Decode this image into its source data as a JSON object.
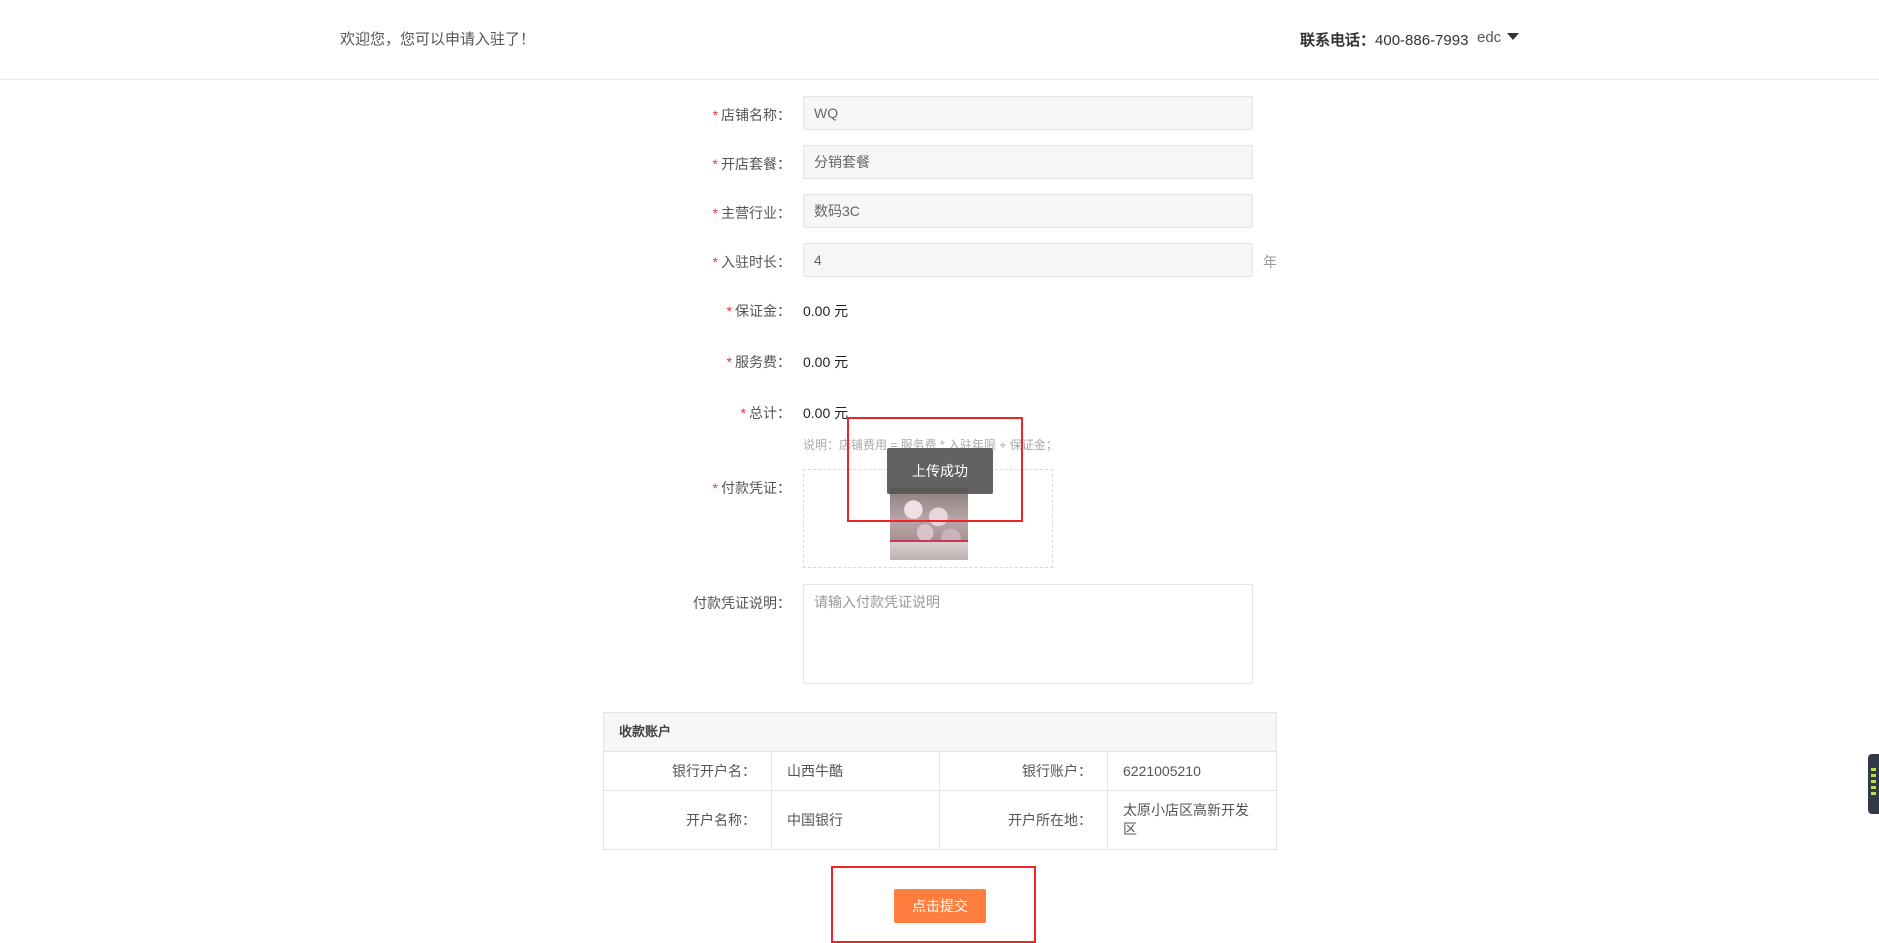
{
  "header": {
    "welcome_text": "欢迎您，您可以申请入驻了！",
    "contact_label": "联系电话：",
    "contact_phone": "400-886-7993",
    "username": "edc"
  },
  "form": {
    "shop_name": {
      "label": "店铺名称：",
      "value": "WQ"
    },
    "package": {
      "label": "开店套餐：",
      "value": "分销套餐"
    },
    "industry": {
      "label": "主营行业：",
      "value": "数码3C"
    },
    "duration": {
      "label": "入驻时长：",
      "value": "4",
      "unit": "年"
    },
    "deposit": {
      "label": "保证金：",
      "value": "0.00 元"
    },
    "service_fee": {
      "label": "服务费：",
      "value": "0.00 元"
    },
    "total": {
      "label": "总计：",
      "value": "0.00 元"
    },
    "note": "说明：店铺费用 = 服务费 * 入驻年限 + 保证金；",
    "voucher": {
      "label": "付款凭证："
    },
    "voucher_desc": {
      "label": "付款凭证说明：",
      "placeholder": "请输入付款凭证说明"
    },
    "required_mark": "*"
  },
  "toast": {
    "text": "上传成功"
  },
  "account": {
    "title": "收款账户",
    "bank_account_name_label": "银行开户名：",
    "bank_account_name": "山西牛酷",
    "bank_account_no_label": "银行账户：",
    "bank_account_no": "6221005210",
    "bank_name_label": "开户名称：",
    "bank_name": "中国银行",
    "bank_location_label": "开户所在地：",
    "bank_location": "太原小店区高新开发区"
  },
  "submit_label": "点击提交",
  "colors": {
    "accent": "#ff7e3e",
    "required": "#e4393c",
    "highlight": "#e8262b"
  }
}
